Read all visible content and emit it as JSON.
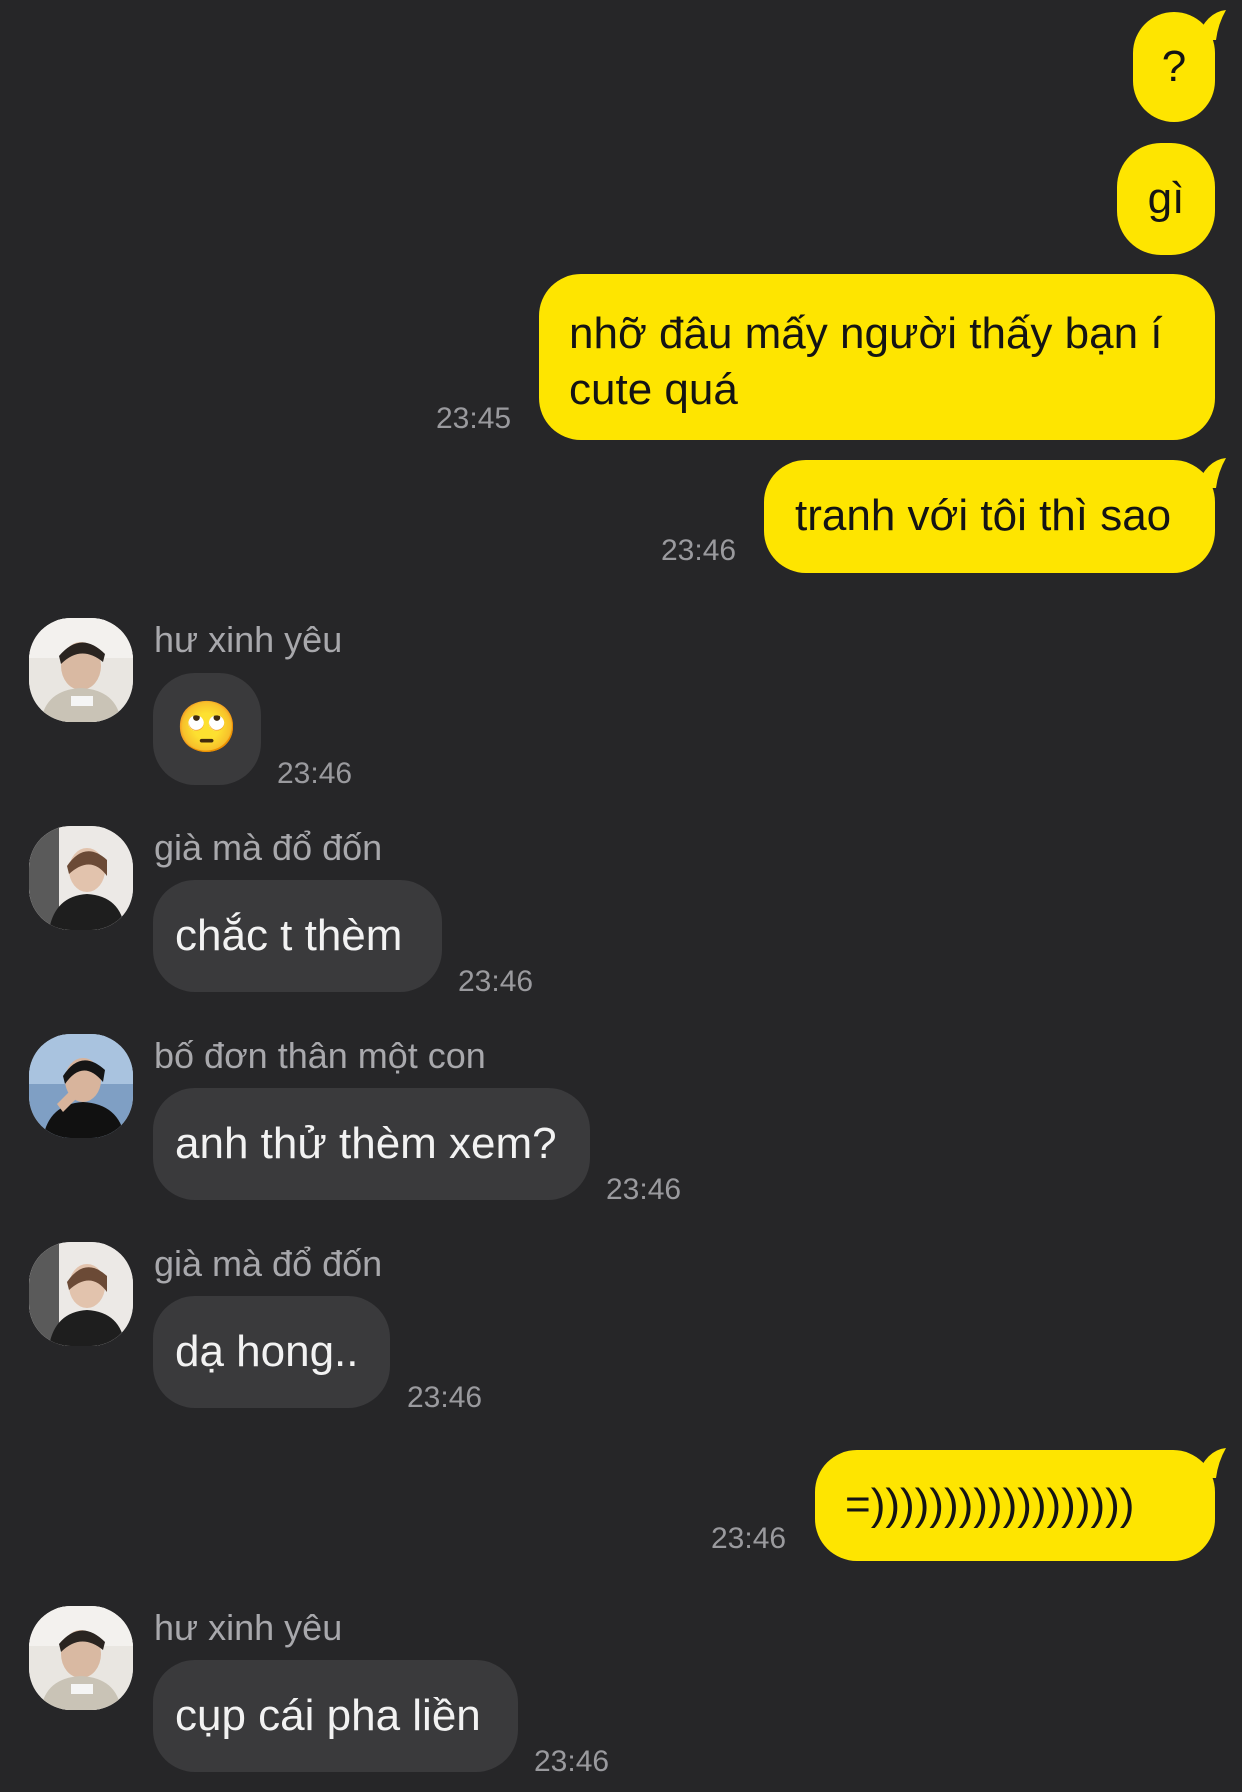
{
  "colors": {
    "background": "#262628",
    "outgoing_bubble": "#FEE500",
    "incoming_bubble": "#3A3A3C",
    "timestamp": "#9A9A9E"
  },
  "messages": [
    {
      "direction": "out",
      "text": "?"
    },
    {
      "direction": "out",
      "text": "gì"
    },
    {
      "direction": "out",
      "text_line1": "nhỡ đâu mấy người thấy bạn í",
      "text_line2": "cute quá",
      "time": "23:45"
    },
    {
      "direction": "out",
      "text": "tranh với tôi thì sao",
      "time": "23:46"
    },
    {
      "direction": "in",
      "sender": "hư xinh yêu",
      "text": "🙄",
      "time": "23:46",
      "avatar": "avatar-hu-xinh-yeu"
    },
    {
      "direction": "in",
      "sender": "già mà đổ đốn",
      "text": "chắc t thèm",
      "time": "23:46",
      "avatar": "avatar-gia-ma-do-don"
    },
    {
      "direction": "in",
      "sender": "bố đơn thân một con",
      "text": "anh thử thèm xem?",
      "time": "23:46",
      "avatar": "avatar-bo-don-than"
    },
    {
      "direction": "in",
      "sender": "già mà đổ đốn",
      "text": "dạ hong..",
      "time": "23:46",
      "avatar": "avatar-gia-ma-do-don"
    },
    {
      "direction": "out",
      "text": "=))))))))))))))))))",
      "time": "23:46"
    },
    {
      "direction": "in",
      "sender": "hư xinh yêu",
      "text": "cụp cái pha liền",
      "time": "23:46",
      "avatar": "avatar-hu-xinh-yeu"
    }
  ]
}
